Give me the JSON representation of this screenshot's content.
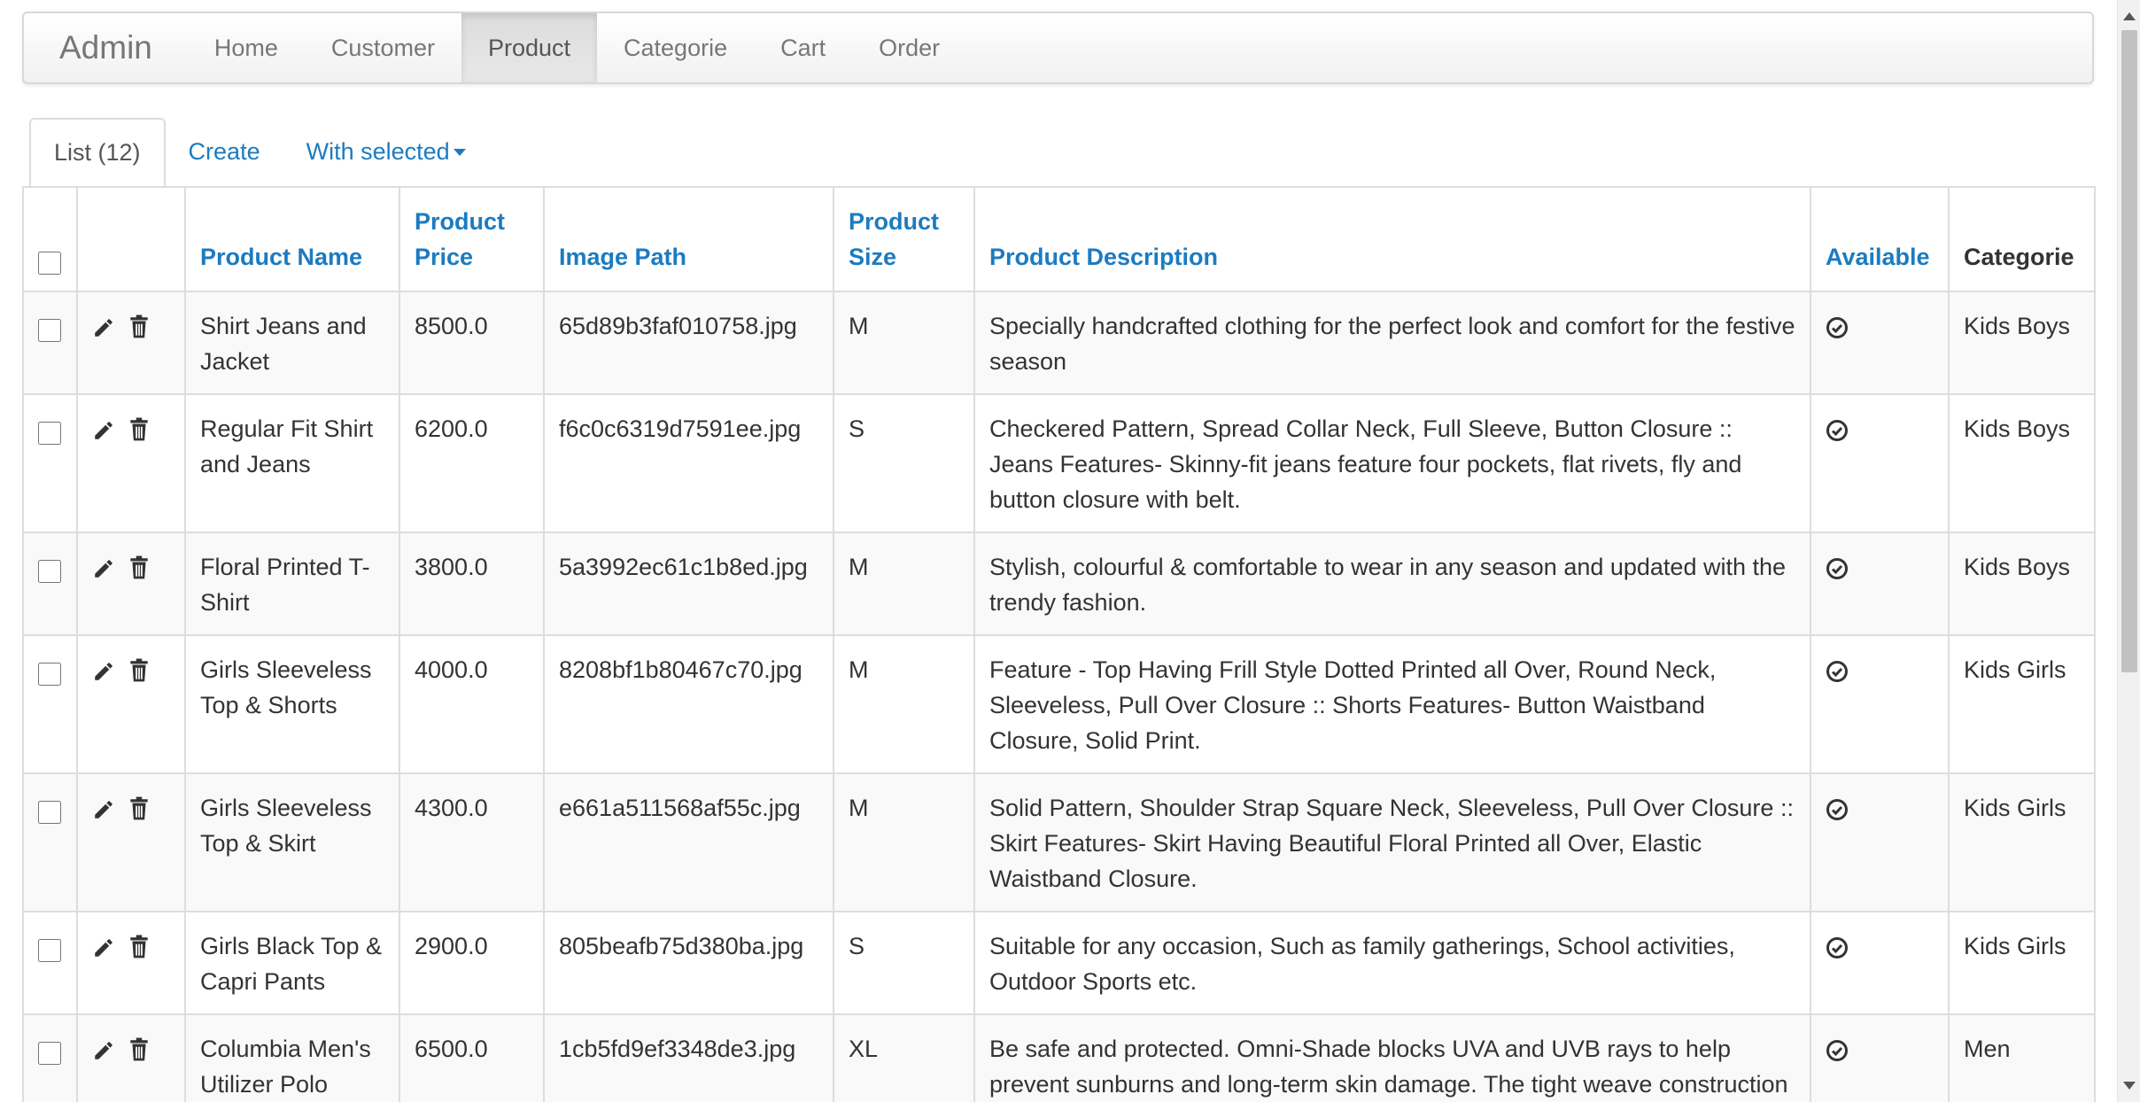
{
  "navbar": {
    "brand": "Admin",
    "items": [
      {
        "label": "Home"
      },
      {
        "label": "Customer"
      },
      {
        "label": "Product"
      },
      {
        "label": "Categorie"
      },
      {
        "label": "Cart"
      },
      {
        "label": "Order"
      }
    ],
    "active": "Product"
  },
  "tabs": {
    "list": "List (12)",
    "create": "Create",
    "with_selected": "With selected"
  },
  "table": {
    "headers": {
      "name": "Product Name",
      "price_line1": "Product",
      "price_line2": "Price",
      "image": "Image Path",
      "size_line1": "Product",
      "size_line2": "Size",
      "description": "Product Description",
      "available": "Available",
      "categorie": "Categorie"
    },
    "rows": [
      {
        "name": "Shirt Jeans and Jacket",
        "price": "8500.0",
        "image": "65d89b3faf010758.jpg",
        "size": "M",
        "description": "Specially handcrafted clothing for the perfect look and comfort for the festive season",
        "categorie": "Kids Boys"
      },
      {
        "name": "Regular Fit Shirt and Jeans",
        "price": "6200.0",
        "image": "f6c0c6319d7591ee.jpg",
        "size": "S",
        "description": "Checkered Pattern, Spread Collar Neck, Full Sleeve, Button Closure :: Jeans Features- Skinny-fit jeans feature four pockets, flat rivets, fly and button closure with belt.",
        "categorie": "Kids Boys"
      },
      {
        "name": "Floral Printed T-Shirt",
        "price": "3800.0",
        "image": "5a3992ec61c1b8ed.jpg",
        "size": "M",
        "description": "Stylish, colourful & comfortable to wear in any season and updated with the trendy fashion.",
        "categorie": "Kids Boys"
      },
      {
        "name": "Girls Sleeveless Top & Shorts",
        "price": "4000.0",
        "image": "8208bf1b80467c70.jpg",
        "size": "M",
        "description": "Feature - Top Having Frill Style Dotted Printed all Over, Round Neck, Sleeveless, Pull Over Closure :: Shorts Features- Button Waistband Closure, Solid Print.",
        "categorie": "Kids Girls"
      },
      {
        "name": "Girls Sleeveless Top & Skirt",
        "price": "4300.0",
        "image": "e661a511568af55c.jpg",
        "size": "M",
        "description": "Solid Pattern, Shoulder Strap Square Neck, Sleeveless, Pull Over Closure :: Skirt Features- Skirt Having Beautiful Floral Printed all Over, Elastic Waistband Closure.",
        "categorie": "Kids Girls"
      },
      {
        "name": "Girls Black Top & Capri Pants",
        "price": "2900.0",
        "image": "805beafb75d380ba.jpg",
        "size": "S",
        "description": "Suitable for any occasion, Such as family gatherings, School activities, Outdoor Sports etc.",
        "categorie": "Kids Girls"
      },
      {
        "name": "Columbia Men's Utilizer Polo",
        "price": "6500.0",
        "image": "1cb5fd9ef3348de3.jpg",
        "size": "XL",
        "description": "Be safe and protected. Omni-Shade blocks UVA and UVB rays to help prevent sunburns and long-term skin damage. The tight weave construction with UV-absorbent yarns block the full spectrum of harmful",
        "categorie": "Men"
      }
    ]
  },
  "icons": {
    "edit": "pencil-icon",
    "delete": "trash-icon",
    "available": "check-circle-icon"
  },
  "colors": {
    "link": "#1c7bc0",
    "text": "#333333",
    "muted": "#777777",
    "border": "#dddddd",
    "stripe": "#f9f9f9"
  }
}
